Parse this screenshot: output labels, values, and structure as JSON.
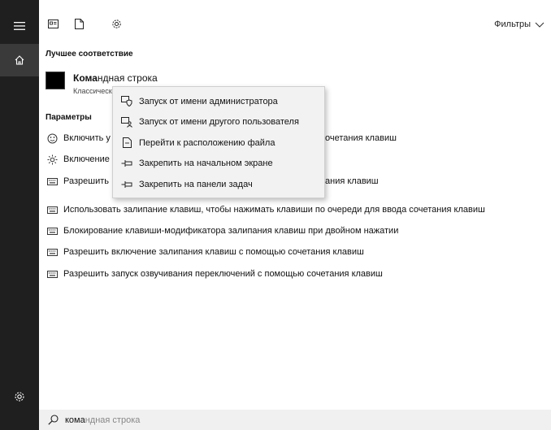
{
  "leftbar": {
    "icons": [
      "hamburger-menu-icon",
      "home-icon",
      "settings-gear-icon"
    ]
  },
  "topbar": {
    "icons": [
      "apps-icon",
      "documents-icon",
      "settings-icon"
    ],
    "filters_label": "Фильтры"
  },
  "best_match": {
    "heading": "Лучшее соответствие",
    "title_bold": "Кома",
    "title_rest": "ндная строка",
    "subtitle": "Классическ"
  },
  "settings_section": {
    "heading": "Параметры",
    "items": [
      {
        "icon": "keyboard-shortcut-icon",
        "text": "Включить у",
        "text_right": "очетания клавиш"
      },
      {
        "icon": "brightness-icon",
        "text": "Включение",
        "text_right": ""
      },
      {
        "icon": "keyboard-icon",
        "text": "Разрешить",
        "text_right": "ания клавиш"
      },
      {
        "icon": "keyboard-icon",
        "text": "Использовать залипание клавиш, чтобы нажимать клавиши по очереди для ввода сочетания клавиш",
        "text_right": ""
      },
      {
        "icon": "keyboard-icon",
        "text": "Блокирование клавиши-модификатора залипания клавиш при двойном нажатии",
        "text_right": ""
      },
      {
        "icon": "keyboard-icon",
        "text": "Разрешить включение залипания клавиш с помощью сочетания клавиш",
        "text_right": ""
      },
      {
        "icon": "keyboard-icon",
        "text": "Разрешить запуск озвучивания переключений с помощью сочетания клавиш",
        "text_right": ""
      }
    ]
  },
  "context_menu": {
    "items": [
      {
        "icon": "run-as-admin-icon",
        "label": "Запуск от имени администратора"
      },
      {
        "icon": "run-as-user-icon",
        "label": "Запуск от имени другого пользователя"
      },
      {
        "icon": "open-file-location-icon",
        "label": "Перейти к расположению файла"
      },
      {
        "icon": "pin-icon",
        "label": "Закрепить на начальном экране"
      },
      {
        "icon": "pin-icon",
        "label": "Закрепить на панели задач"
      }
    ]
  },
  "search": {
    "typed": "кома",
    "suggestion": "ндная строка"
  }
}
